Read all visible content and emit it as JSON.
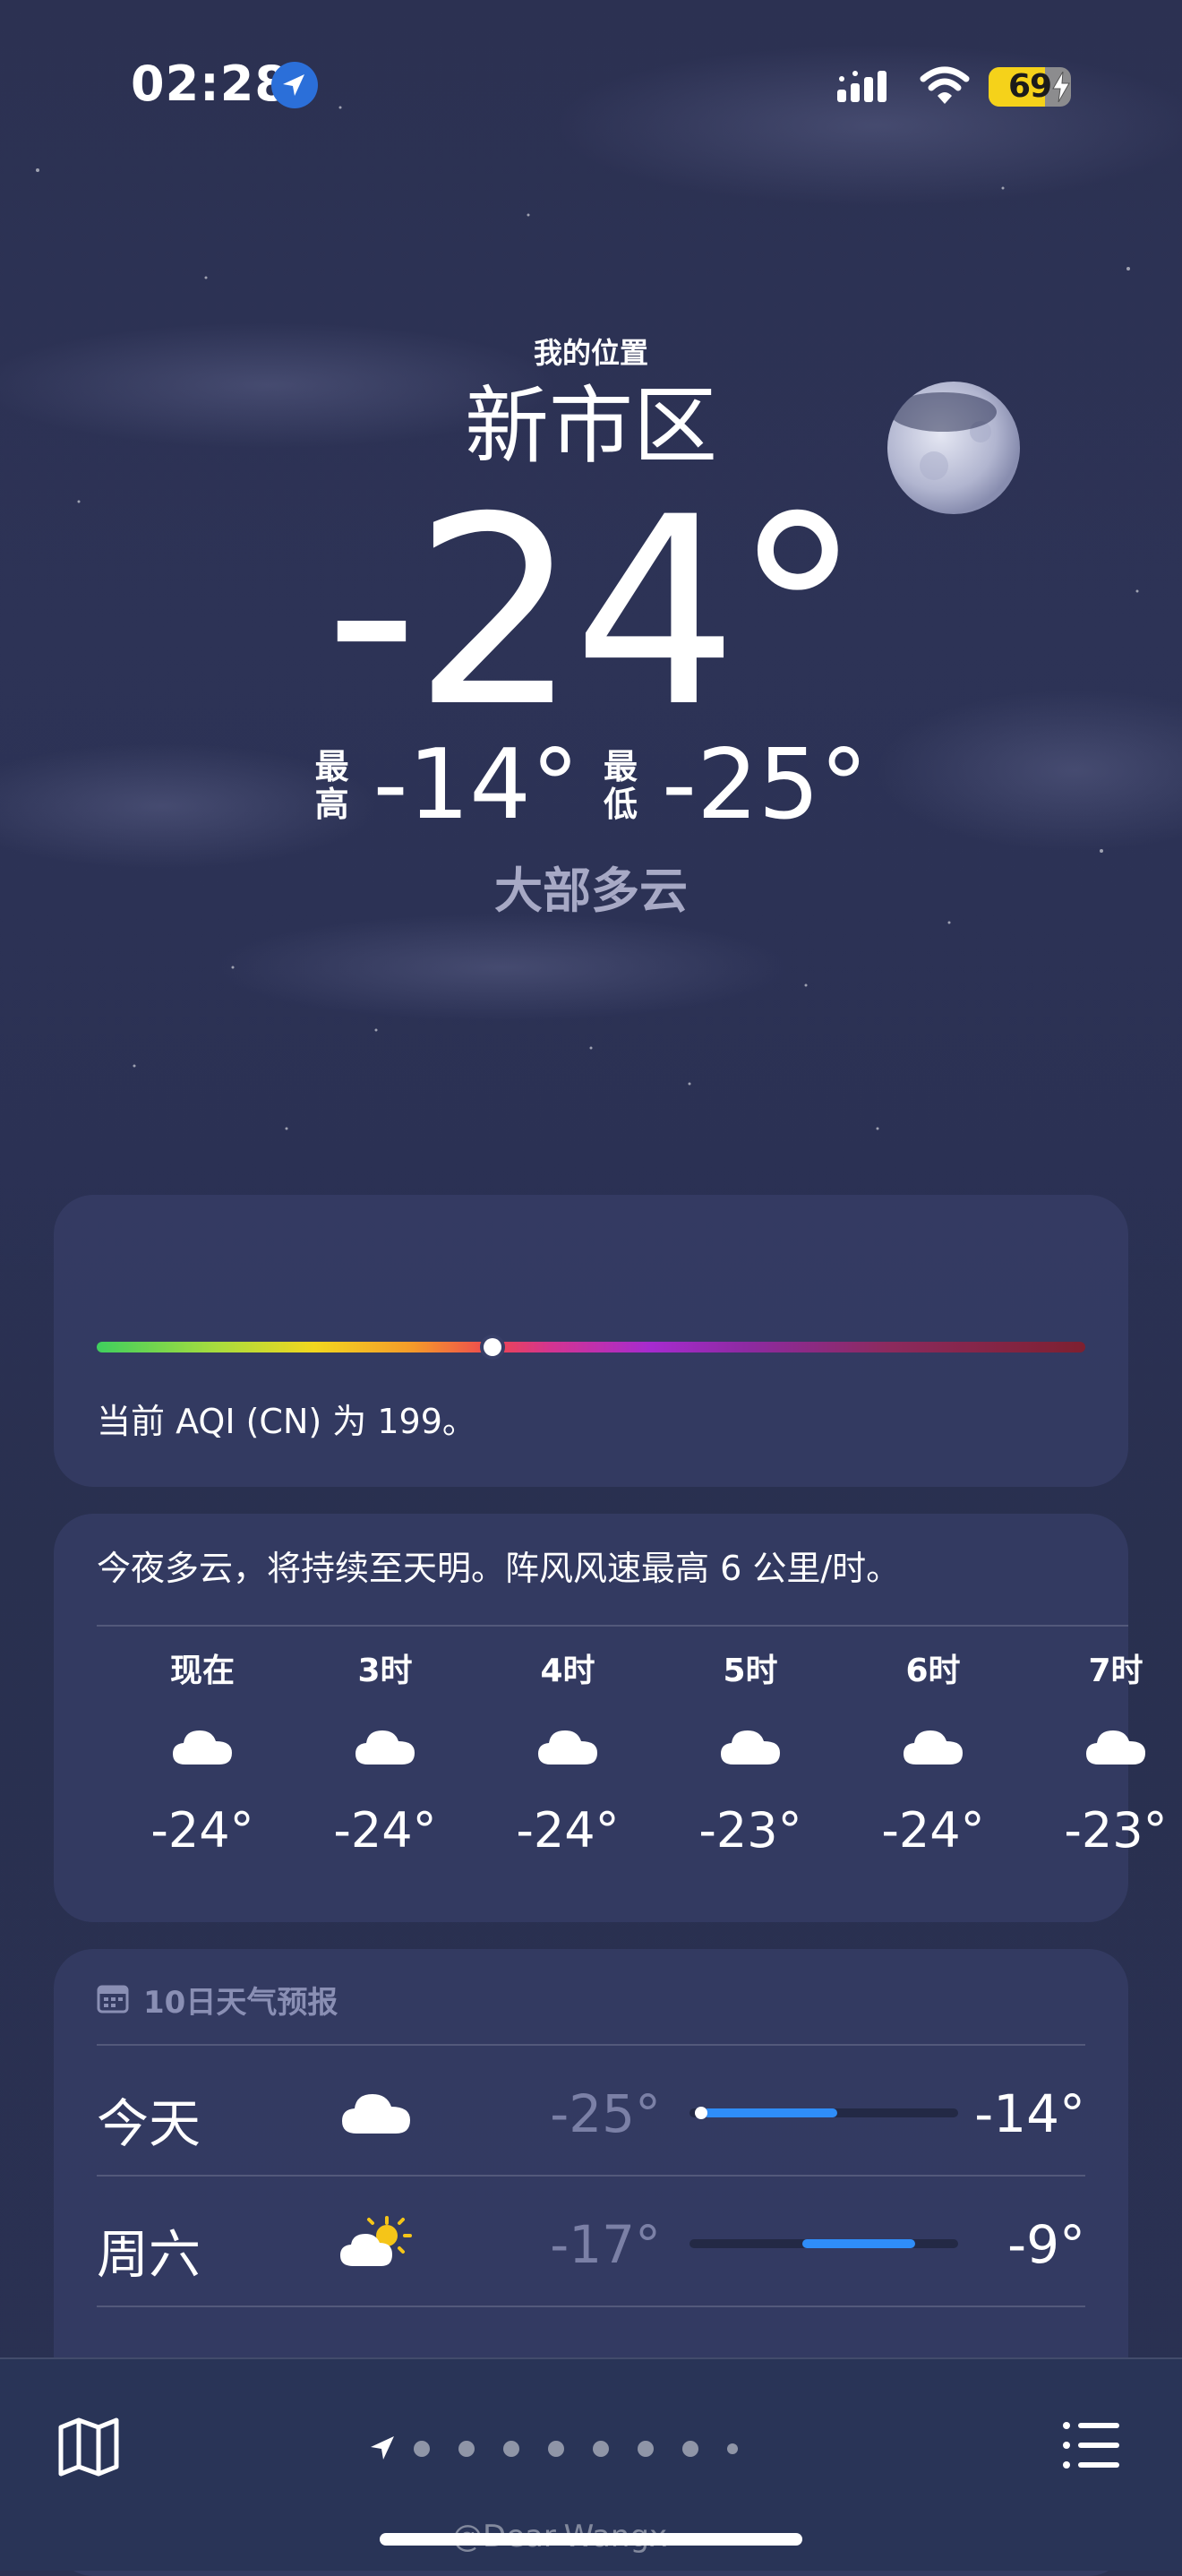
{
  "status_bar": {
    "time": "02:28",
    "battery": "69",
    "battery_fraction": 0.69
  },
  "location": {
    "label": "我的位置",
    "city": "新市区",
    "current_temp": "-24°",
    "high_label": "最高",
    "high": "-14°",
    "low_label": "最低",
    "low": "-25°",
    "condition": "大部多云"
  },
  "aqi": {
    "text": "当前 AQI (CN) 为 199。",
    "position_fraction": 0.4
  },
  "hourly": {
    "summary": "今夜多云，将持续至天明。阵风风速最高 6 公里/时。",
    "hours": [
      {
        "label": "现在",
        "icon": "cloud-icon",
        "temp": "-24°"
      },
      {
        "label": "3时",
        "icon": "cloud-icon",
        "temp": "-24°"
      },
      {
        "label": "4时",
        "icon": "cloud-icon",
        "temp": "-24°"
      },
      {
        "label": "5时",
        "icon": "cloud-icon",
        "temp": "-23°"
      },
      {
        "label": "6时",
        "icon": "cloud-icon",
        "temp": "-24°"
      },
      {
        "label": "7时",
        "icon": "cloud-icon",
        "temp": "-23°"
      }
    ]
  },
  "ten_day": {
    "title": "10日天气预报",
    "days": [
      {
        "name": "今天",
        "icon": "cloud-icon",
        "low": "-25°",
        "high": "-14°",
        "range_start": 0.05,
        "range_end": 0.55,
        "current": 0.02
      },
      {
        "name": "周六",
        "icon": "partly-sunny-icon",
        "low": "-17°",
        "high": "-9°",
        "range_start": 0.42,
        "range_end": 0.84
      }
    ]
  },
  "tab_bar": {
    "page_count": 9,
    "watermark": "@Dear-Wangx"
  },
  "colors": {
    "accent_blue": "#2f8df8",
    "battery_yellow": "#f5d21a",
    "card_bg": "#383f68"
  }
}
